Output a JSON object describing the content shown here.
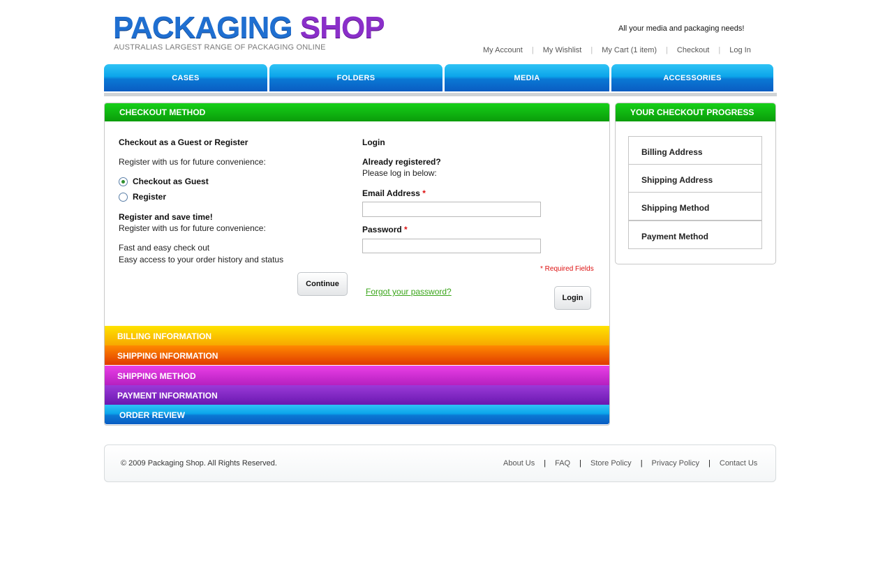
{
  "header": {
    "logo_part1": "PACKAGING",
    "logo_part2": "SHOP",
    "logo_tagline": "AUSTRALIAS LARGEST RANGE OF PACKAGING ONLINE",
    "tagline": "All your media and packaging needs!",
    "links": [
      "My Account",
      "My Wishlist",
      "My Cart (1 item)",
      "Checkout",
      "Log In"
    ],
    "separator": "|"
  },
  "nav": [
    "CASES",
    "FOLDERS",
    "MEDIA",
    "ACCESSORIES"
  ],
  "checkout": {
    "section_title": "CHECKOUT METHOD",
    "guest": {
      "heading": "Checkout as a Guest or Register",
      "intro": "Register with us for future convenience:",
      "options": [
        "Checkout as Guest",
        "Register"
      ],
      "selected": "Checkout as Guest",
      "save_heading": "Register and save time!",
      "save_intro": "Register with us for future convenience:",
      "benefits": [
        "Fast and easy check out",
        "Easy access to your order history and status"
      ],
      "continue_label": "Continue"
    },
    "login": {
      "heading": "Login",
      "already": "Already registered?",
      "please": "Please log in below:",
      "email_label": "Email Address",
      "email_value": "",
      "password_label": "Password",
      "password_value": "",
      "required_star": "*",
      "required_note": "* Required Fields",
      "forgot_label": "Forgot your password?",
      "login_label": "Login"
    },
    "steps": [
      {
        "label": "BILLING INFORMATION",
        "color": "#f7a800"
      },
      {
        "label": "SHIPPING INFORMATION",
        "color": "#ec4a00"
      },
      {
        "label": "SHIPPING METHOD",
        "color": "#c42fcf"
      },
      {
        "label": "PAYMENT INFORMATION",
        "color": "#7b24c0"
      },
      {
        "label": "ORDER REVIEW",
        "color": "#0a78d4"
      }
    ]
  },
  "progress": {
    "title": "YOUR CHECKOUT PROGRESS",
    "items": [
      "Billing Address",
      "Shipping Address",
      "Shipping Method",
      "Payment Method"
    ]
  },
  "footer": {
    "copyright": "© 2009 Packaging Shop. All Rights Reserved.",
    "links": [
      "About Us",
      "FAQ",
      "Store Policy",
      "Privacy Policy",
      "Contact Us"
    ],
    "separator": "|"
  },
  "colors": {
    "nav_blue": "#0a9be6",
    "section_green": "#12bb12",
    "link_green": "#3aa51a",
    "required_red": "#dd1111"
  }
}
